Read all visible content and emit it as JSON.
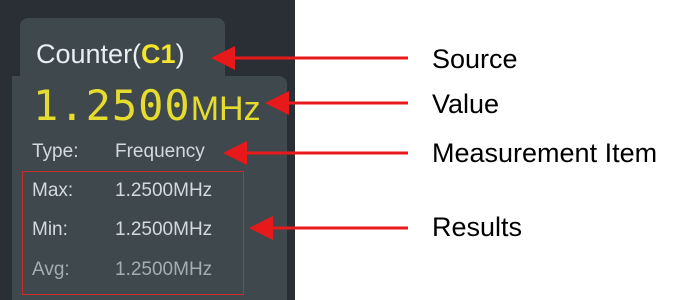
{
  "panel": {
    "title": "Counter(",
    "source": "C1",
    "title_close": ")",
    "value": "1.2500",
    "value_unit": "MHz",
    "type_label": "Type:",
    "type_value": "Frequency",
    "results": [
      {
        "label": "Max:",
        "value": "1.2500MHz"
      },
      {
        "label": "Min:",
        "value": "1.2500MHz"
      },
      {
        "label": "Avg:",
        "value": "1.2500MHz"
      }
    ]
  },
  "annotations": {
    "source": "Source",
    "value": "Value",
    "measurement_item": "Measurement Item",
    "results": "Results"
  },
  "colors": {
    "arrow": "#e8191a",
    "source_highlight": "#f5e52a",
    "value": "#e6dc2e",
    "panel_bg": "#3e484d"
  }
}
